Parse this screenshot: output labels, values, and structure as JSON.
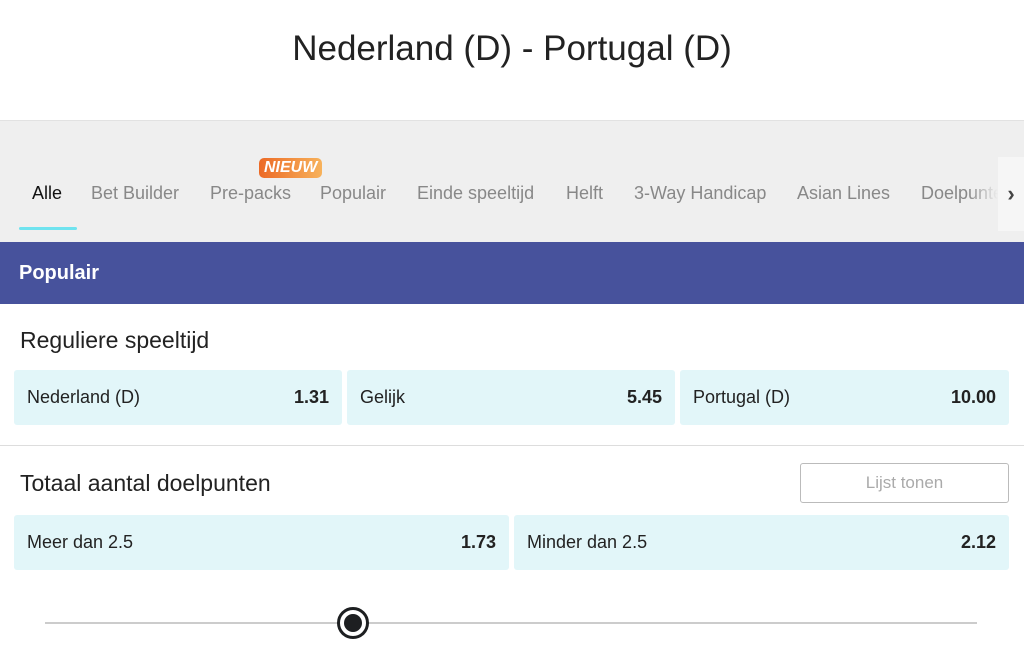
{
  "header": {
    "title": "Nederland (D) - Portugal (D)"
  },
  "tabs": [
    {
      "label": "Alle",
      "active": true
    },
    {
      "label": "Bet Builder"
    },
    {
      "label": "Pre-packs",
      "badge": "NIEUW"
    },
    {
      "label": "Populair"
    },
    {
      "label": "Einde speeltijd"
    },
    {
      "label": "Helft"
    },
    {
      "label": "3-Way Handicap"
    },
    {
      "label": "Asian Lines"
    },
    {
      "label": "Doelpunten"
    }
  ],
  "tabs_scroll_icon": "chevron-right-icon",
  "section": {
    "title": "Populair"
  },
  "markets": [
    {
      "title": "Reguliere speeltijd",
      "selections": [
        {
          "label": "Nederland (D)",
          "odds": "1.31"
        },
        {
          "label": "Gelijk",
          "odds": "5.45"
        },
        {
          "label": "Portugal (D)",
          "odds": "10.00"
        }
      ]
    },
    {
      "title": "Totaal aantal doelpunten",
      "button": "Lijst tonen",
      "selections": [
        {
          "label": "Meer dan 2.5",
          "odds": "1.73"
        },
        {
          "label": "Minder dan 2.5",
          "odds": "2.12"
        }
      ]
    }
  ],
  "slider": {
    "value_fraction": 0.33
  },
  "colors": {
    "section_bg": "#47529c",
    "odds_bg": "#e2f6f9",
    "active_tab_underline": "#6fe3ef",
    "badge": "#ec6a26"
  }
}
